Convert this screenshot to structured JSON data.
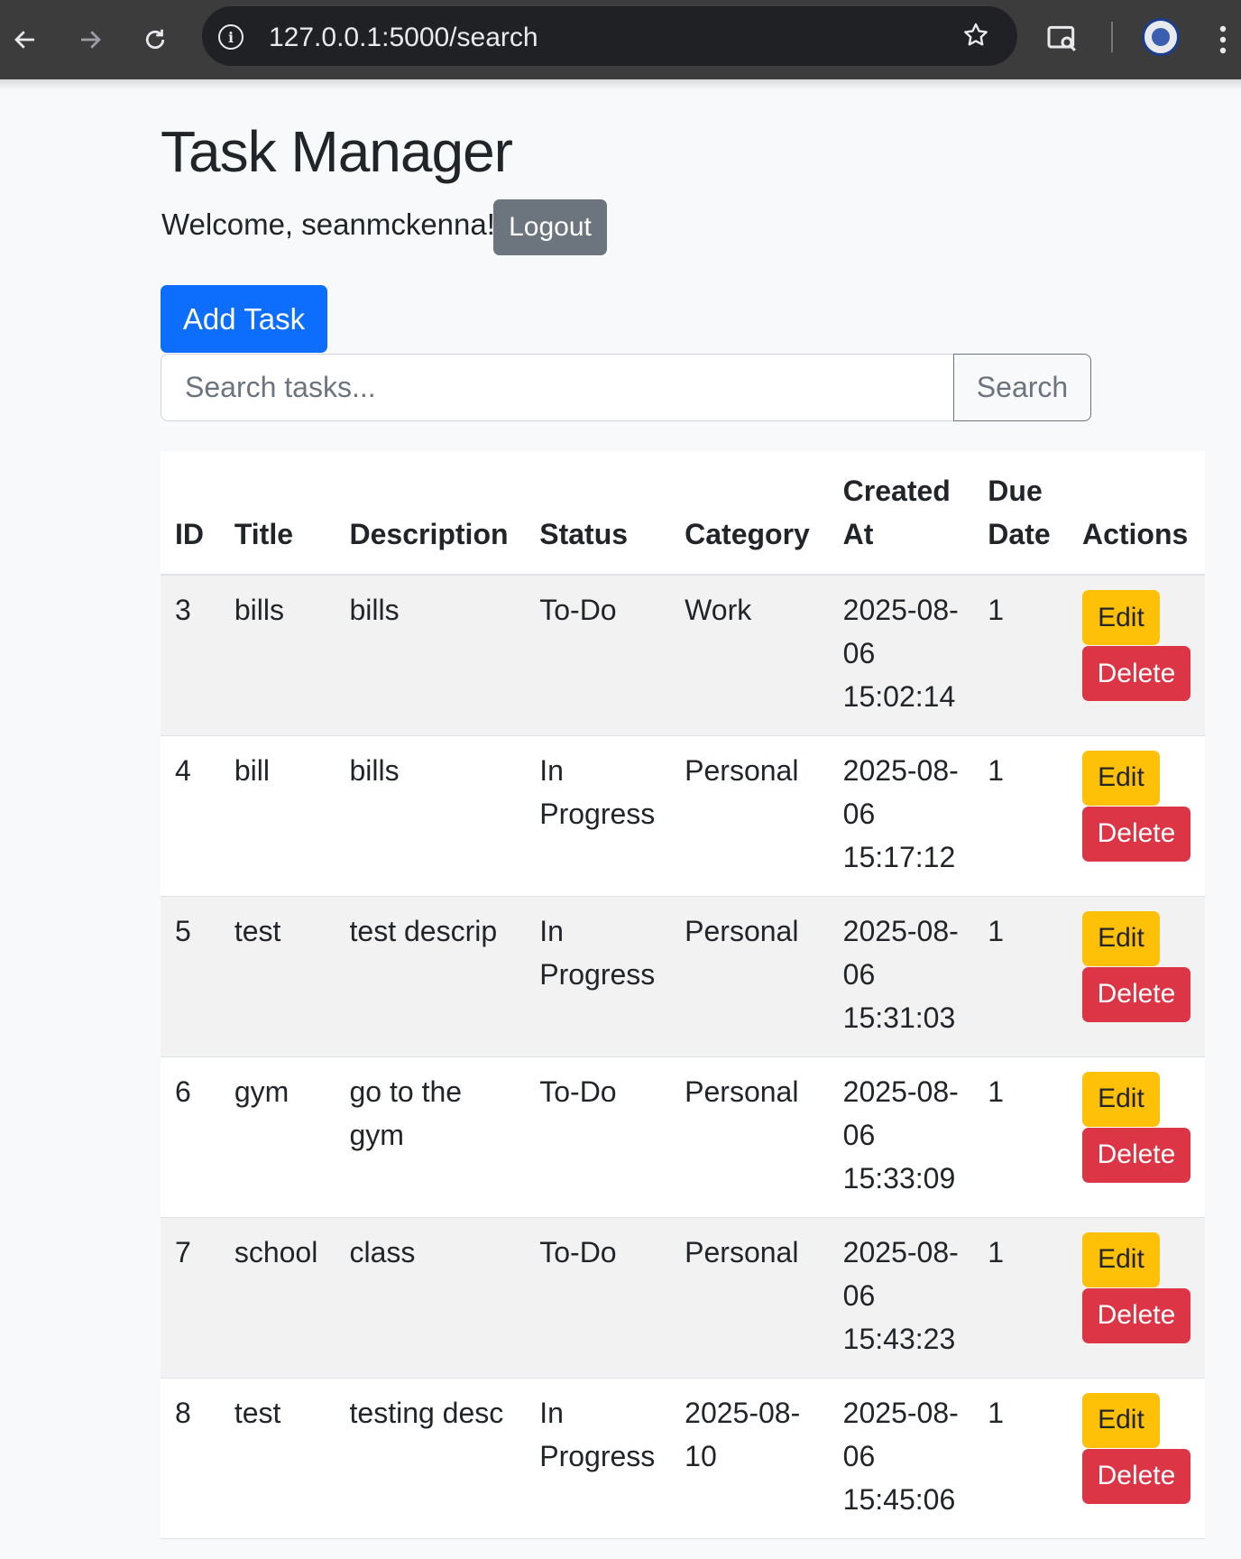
{
  "browser": {
    "url": "127.0.0.1:5000/search",
    "info_glyph": "i"
  },
  "page": {
    "title": "Task Manager",
    "welcome": "Welcome, seanmckenna!",
    "logout_label": "Logout",
    "add_task_label": "Add Task",
    "search_placeholder": "Search tasks...",
    "search_label": "Search"
  },
  "table": {
    "headers": [
      "ID",
      "Title",
      "Description",
      "Status",
      "Category",
      "Created At",
      "Due Date",
      "Actions"
    ],
    "rows": [
      {
        "id": "3",
        "title": "bills",
        "description": "bills",
        "status": "To-Do",
        "category": "Work",
        "created_at": "2025-08-06 15:02:14",
        "due_date": "1"
      },
      {
        "id": "4",
        "title": "bill",
        "description": "bills",
        "status": "In Progress",
        "category": "Personal",
        "created_at": "2025-08-06 15:17:12",
        "due_date": "1"
      },
      {
        "id": "5",
        "title": "test",
        "description": "test descrip",
        "status": "In Progress",
        "category": "Personal",
        "created_at": "2025-08-06 15:31:03",
        "due_date": "1"
      },
      {
        "id": "6",
        "title": "gym",
        "description": "go to the gym",
        "status": "To-Do",
        "category": "Personal",
        "created_at": "2025-08-06 15:33:09",
        "due_date": "1"
      },
      {
        "id": "7",
        "title": "school",
        "description": "class",
        "status": "To-Do",
        "category": "Personal",
        "created_at": "2025-08-06 15:43:23",
        "due_date": "1"
      },
      {
        "id": "8",
        "title": "test",
        "description": "testing desc",
        "status": "In Progress",
        "category": "2025-08-10",
        "created_at": "2025-08-06 15:45:06",
        "due_date": "1"
      }
    ],
    "edit_label": "Edit",
    "delete_label": "Delete"
  },
  "colors": {
    "primary": "#0d6efd",
    "secondary": "#6c757d",
    "warning": "#ffc107",
    "danger": "#dc3545",
    "chrome_bar": "#3c3c3c"
  }
}
